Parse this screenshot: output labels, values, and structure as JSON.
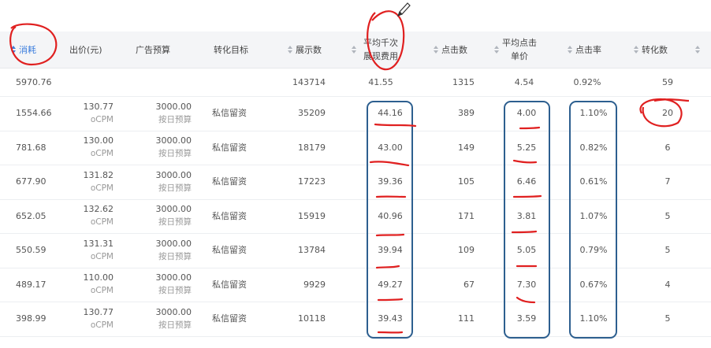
{
  "headers": {
    "spend": "消耗",
    "bid": "出价(元)",
    "budget": "广告预算",
    "goal": "转化目标",
    "impressions": "展示数",
    "cpm": "平均千次展现费用",
    "clicks": "点击数",
    "cpc": "平均点击单价",
    "ctr": "点击率",
    "conversions": "转化数"
  },
  "summary": {
    "spend": "5970.76",
    "impressions": "143714",
    "cpm": "41.55",
    "clicks": "1315",
    "cpc": "4.54",
    "ctr": "0.92%",
    "conversions": "59"
  },
  "rows": [
    {
      "spend": "1554.66",
      "bid": "130.77",
      "bid_type": "oCPM",
      "budget": "3000.00",
      "budget_type": "按日预算",
      "goal": "私信留资",
      "impressions": "35209",
      "cpm": "44.16",
      "clicks": "389",
      "cpc": "4.00",
      "ctr": "1.10%",
      "conversions": "20"
    },
    {
      "spend": "781.68",
      "bid": "130.00",
      "bid_type": "oCPM",
      "budget": "3000.00",
      "budget_type": "按日预算",
      "goal": "私信留资",
      "impressions": "18179",
      "cpm": "43.00",
      "clicks": "149",
      "cpc": "5.25",
      "ctr": "0.82%",
      "conversions": "6"
    },
    {
      "spend": "677.90",
      "bid": "131.82",
      "bid_type": "oCPM",
      "budget": "3000.00",
      "budget_type": "按日预算",
      "goal": "私信留资",
      "impressions": "17223",
      "cpm": "39.36",
      "clicks": "105",
      "cpc": "6.46",
      "ctr": "0.61%",
      "conversions": "7"
    },
    {
      "spend": "652.05",
      "bid": "132.62",
      "bid_type": "oCPM",
      "budget": "3000.00",
      "budget_type": "按日预算",
      "goal": "私信留资",
      "impressions": "15919",
      "cpm": "40.96",
      "clicks": "171",
      "cpc": "3.81",
      "ctr": "1.07%",
      "conversions": "5"
    },
    {
      "spend": "550.59",
      "bid": "131.31",
      "bid_type": "oCPM",
      "budget": "3000.00",
      "budget_type": "按日预算",
      "goal": "私信留资",
      "impressions": "13784",
      "cpm": "39.94",
      "clicks": "109",
      "cpc": "5.05",
      "ctr": "0.79%",
      "conversions": "5"
    },
    {
      "spend": "489.17",
      "bid": "110.00",
      "bid_type": "oCPM",
      "budget": "3000.00",
      "budget_type": "按日预算",
      "goal": "私信留资",
      "impressions": "9929",
      "cpm": "49.27",
      "clicks": "67",
      "cpc": "7.30",
      "ctr": "0.67%",
      "conversions": "4"
    },
    {
      "spend": "398.99",
      "bid": "130.77",
      "bid_type": "oCPM",
      "budget": "3000.00",
      "budget_type": "按日预算",
      "goal": "私信留资",
      "impressions": "10118",
      "cpm": "39.43",
      "clicks": "111",
      "cpc": "3.59",
      "ctr": "1.10%",
      "conversions": "5"
    }
  ],
  "colors": {
    "header_bg": "#f4f5f7",
    "sort_active": "#3b7ddd",
    "annotation_red": "#e02020",
    "annotation_blue": "#2d5f8f"
  },
  "icons": [
    "sort-icon",
    "pen-cursor-icon"
  ]
}
